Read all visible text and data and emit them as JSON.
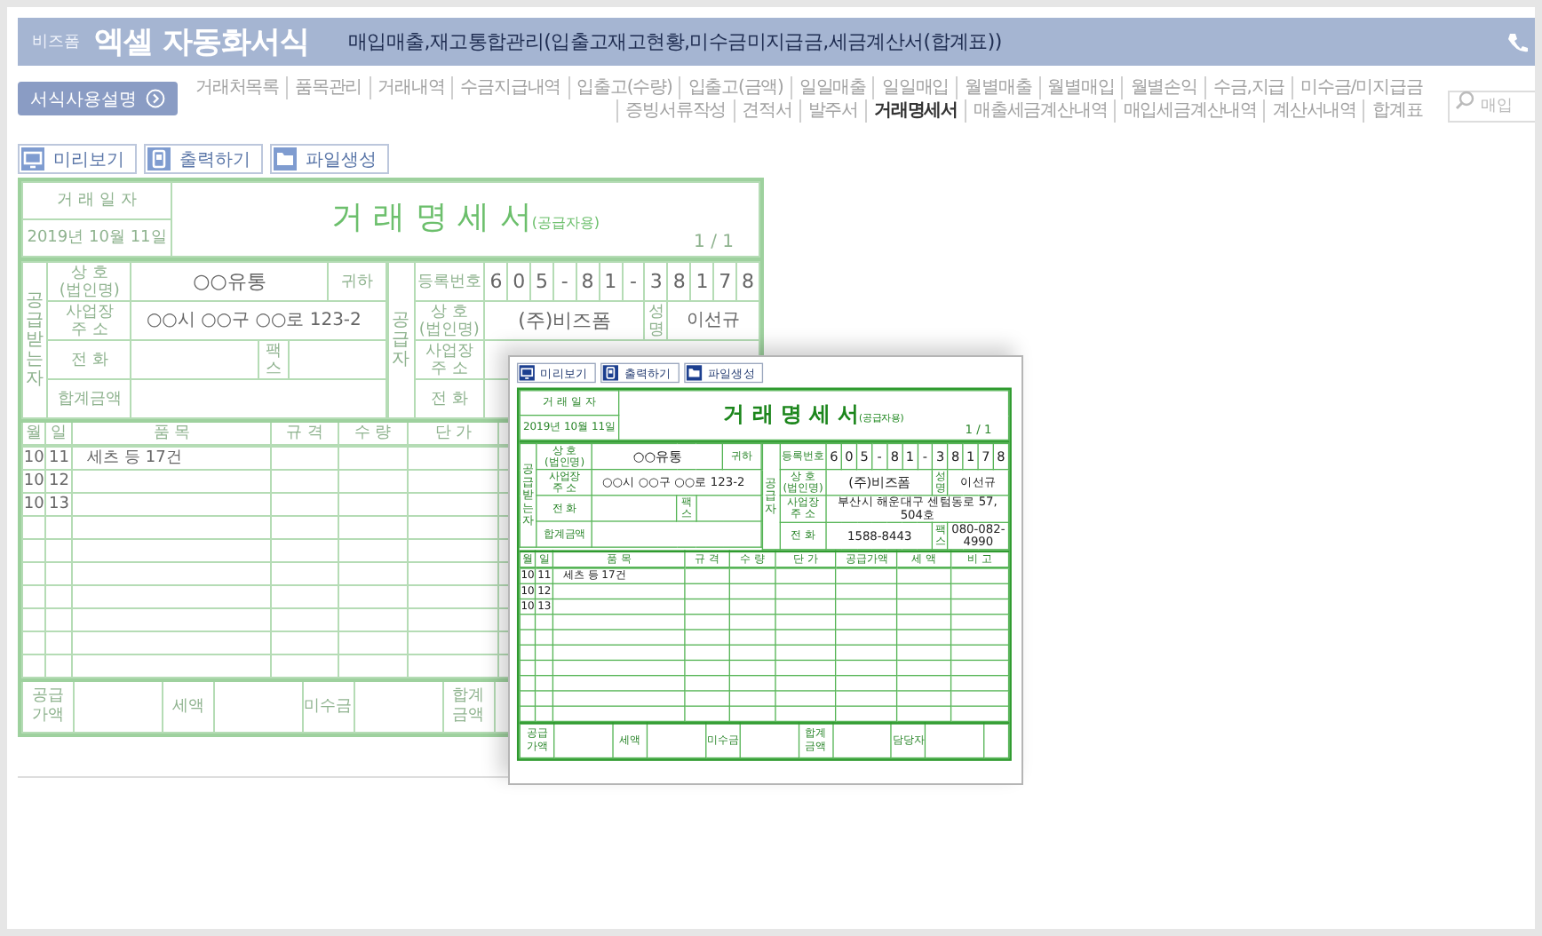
{
  "header": {
    "logo": "비즈폼",
    "title": "엑셀 자동화서식",
    "subtitle": "매입매출,재고통합관리(입출고재고현황,미수금미지급금,세금계산서(합계표))"
  },
  "guide_button": "서식사용설명",
  "nav_rows": [
    [
      {
        "label": "거래처목록",
        "selected": false
      },
      {
        "label": "품목관리",
        "selected": false
      },
      {
        "label": "거래내역",
        "selected": false
      },
      {
        "label": "수금지급내역",
        "selected": false
      },
      {
        "label": "입출고(수량)",
        "selected": false
      },
      {
        "label": "입출고(금액)",
        "selected": false
      },
      {
        "label": "일일매출",
        "selected": false
      },
      {
        "label": "일일매입",
        "selected": false
      },
      {
        "label": "월별매출",
        "selected": false
      },
      {
        "label": "월별매입",
        "selected": false
      },
      {
        "label": "월별손익",
        "selected": false
      },
      {
        "label": "수금,지급",
        "selected": false
      },
      {
        "label": "미수금/미지급금",
        "selected": false
      }
    ],
    [
      {
        "label": "증빙서류작성",
        "selected": false
      },
      {
        "label": "견적서",
        "selected": false
      },
      {
        "label": "발주서",
        "selected": false
      },
      {
        "label": "거래명세서",
        "selected": true
      },
      {
        "label": "매출세금계산내역",
        "selected": false
      },
      {
        "label": "매입세금계산내역",
        "selected": false
      },
      {
        "label": "계산서내역",
        "selected": false
      },
      {
        "label": "합계표",
        "selected": false
      }
    ]
  ],
  "search": {
    "placeholder": "매입"
  },
  "toolbar": [
    {
      "label": "미리보기",
      "kind": "preview"
    },
    {
      "label": "출력하기",
      "kind": "print"
    },
    {
      "label": "파일생성",
      "kind": "file"
    }
  ],
  "invoice": {
    "date_label": "거 래 일 자",
    "date": "2019년 10월 11일",
    "title": "거 래 명 세 서",
    "title_note": "(공급자용)",
    "page": "1 / 1",
    "receiver": {
      "label": "공급받는자",
      "name_label": "상 호\n(법인명)",
      "name": "○○유통",
      "honorific": "귀하",
      "address_label": "사업장\n주 소",
      "address": "○○시 ○○구 ○○로 123-2",
      "phone_label": "전 화",
      "fax_label": "팩\n스",
      "total_label": "합계금액"
    },
    "supplier": {
      "label": "공급자",
      "reg_label": "등록번호",
      "reg_digits": [
        "6",
        "0",
        "5",
        "-",
        "8",
        "1",
        "-",
        "3",
        "8",
        "1",
        "7",
        "8"
      ],
      "name_label": "상 호\n(법인명)",
      "name": "(주)비즈폼",
      "owner_label": "성\n명",
      "owner": "이선규",
      "address_label": "사업장\n주 소",
      "phone_label": "전 화"
    },
    "columns": [
      "월",
      "일",
      "품 목",
      "규 격",
      "수 량",
      "단 가"
    ],
    "rows": [
      [
        "10",
        "11",
        "세츠 등 17건"
      ],
      [
        "10",
        "12"
      ],
      [
        "10",
        "13"
      ]
    ],
    "footer": [
      "공급\n가액",
      "세액",
      "미수금",
      "합계\n금액"
    ]
  },
  "preview": {
    "toolbar": [
      {
        "label": "미리보기",
        "kind": "preview"
      },
      {
        "label": "출력하기",
        "kind": "print"
      },
      {
        "label": "파일생성",
        "kind": "file"
      }
    ],
    "invoice": {
      "date_label": "거 래 일 자",
      "date": "2019년 10월 11일",
      "title": "거 래 명 세 서",
      "title_note": "(공급자용)",
      "page": "1 / 1",
      "receiver": {
        "label": "공급받는자",
        "name_label": "상 호\n(법인명)",
        "name": "○○유통",
        "honorific": "귀하",
        "address_label": "사업장\n주 소",
        "address": "○○시 ○○구 ○○로 123-2",
        "phone_label": "전 화",
        "fax_label": "팩\n스",
        "total_label": "합계금액"
      },
      "supplier": {
        "label": "공급자",
        "reg_label": "등록번호",
        "reg_digits": [
          "6",
          "0",
          "5",
          "-",
          "8",
          "1",
          "-",
          "3",
          "8",
          "1",
          "7",
          "8"
        ],
        "name_label": "상 호\n(법인명)",
        "name": "(주)비즈폼",
        "owner_label": "성\n명",
        "owner": "이선규",
        "address_label": "사업장\n주 소",
        "address": "부산시 해운대구 센텀동로 57, 504호",
        "phone_label": "전 화",
        "phone": "1588-8443",
        "fax_label": "팩\n스",
        "fax": "080-082-4990"
      },
      "columns": [
        "월",
        "일",
        "품 목",
        "규 격",
        "수 량",
        "단 가",
        "공급가액",
        "세 액",
        "비 고"
      ],
      "rows": [
        [
          "10",
          "11",
          "세츠 등 17건"
        ],
        [
          "10",
          "12"
        ],
        [
          "10",
          "13"
        ]
      ],
      "footer": [
        "공급\n가액",
        "세액",
        "미수금",
        "합계\n금액",
        "담당자"
      ]
    }
  }
}
